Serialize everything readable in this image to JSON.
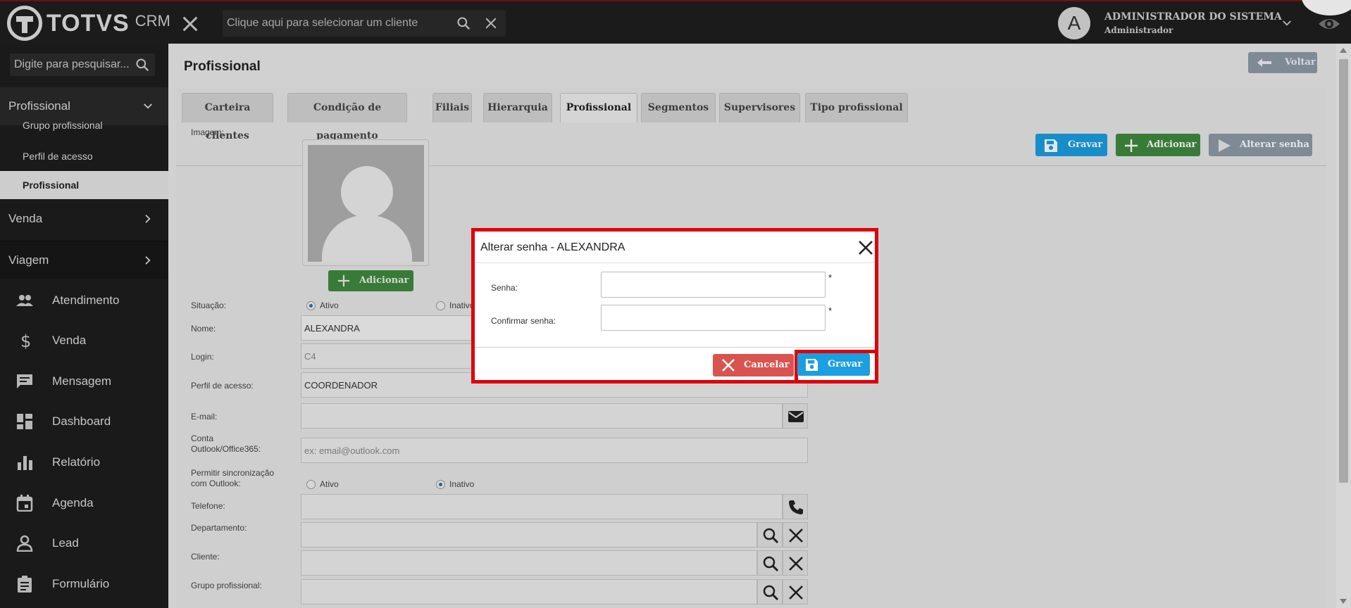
{
  "topbar": {
    "logo_text": "TOTVS",
    "logo_sub": "CRM",
    "client_search_placeholder": "Clique aqui para selecionar um cliente",
    "user_initial": "A",
    "user_name": "ADMINISTRADOR DO SISTEMA",
    "user_role": "Administrador"
  },
  "sidebar": {
    "search_placeholder": "Digite para pesquisar...",
    "section_profissional": "Profissional",
    "sub_items": [
      "Grupo profissional",
      "Perfil de acesso",
      "Profissional"
    ],
    "section_venda": "Venda",
    "section_viagem": "Viagem",
    "nav": [
      "Atendimento",
      "Venda",
      "Mensagem",
      "Dashboard",
      "Relatório",
      "Agenda",
      "Lead",
      "Formulário"
    ]
  },
  "main": {
    "title": "Profissional",
    "back_label": "Voltar",
    "tabs": [
      "Carteira clientes",
      "Condição de pagamento",
      "Filiais",
      "Hierarquia",
      "Profissional",
      "Segmentos",
      "Supervisores",
      "Tipo profissional"
    ],
    "active_tab": "Profissional",
    "actions": {
      "save": "Gravar",
      "add": "Adicionar",
      "change_password": "Alterar senha"
    }
  },
  "form": {
    "image_label": "Imagem:",
    "add_photo_label": "Adicionar",
    "situacao_label": "Situação:",
    "situacao_options": [
      "Ativo",
      "Inativo"
    ],
    "nome_label": "Nome:",
    "nome_value": "ALEXANDRA",
    "login_label": "Login:",
    "login_value": "C4",
    "perfil_label": "Perfil de acesso:",
    "perfil_value": "COORDENADOR",
    "email_label": "E-mail:",
    "outlook_label": "Conta Outlook/Office365:",
    "outlook_placeholder": "ex: email@outlook.com",
    "sync_label": "Permitir sincronização com Outlook:",
    "sync_options": [
      "Ativo",
      "Inativo"
    ],
    "telefone_label": "Telefone:",
    "departamento_label": "Departamento:",
    "cliente_label": "Cliente:",
    "grupo_label": "Grupo profissional:"
  },
  "modal": {
    "title": "Alterar senha - ALEXANDRA",
    "senha_label": "Senha:",
    "confirmar_label": "Confirmar senha:",
    "required_mark": "*",
    "cancel_label": "Cancelar",
    "save_label": "Gravar"
  },
  "colors": {
    "highlight": "#e0000a",
    "save_blue": "#1a9fe0",
    "add_green": "#3f8a3f",
    "cancel_red": "#d9534f"
  }
}
